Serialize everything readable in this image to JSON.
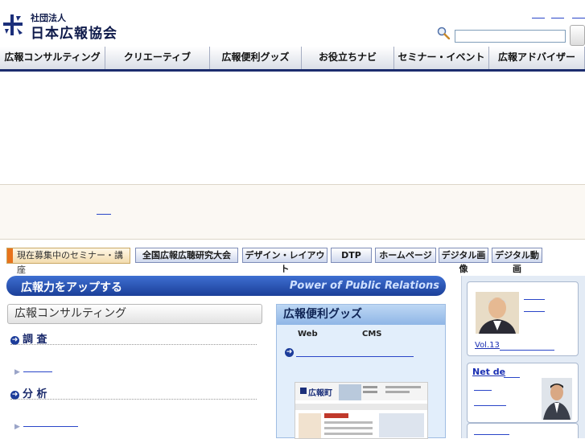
{
  "header": {
    "logo_small": "社団法人",
    "logo_big": "日本広報協会",
    "search_placeholder": ""
  },
  "nav": {
    "items": [
      {
        "label": "広報コンサルティング"
      },
      {
        "label": "クリエーティブ"
      },
      {
        "label": "広報便利グッズ"
      },
      {
        "label": "お役立ちナビ"
      },
      {
        "label": "セミナー・イベント"
      },
      {
        "label": "広報アドバイザー"
      }
    ]
  },
  "seminar_bar": {
    "label": "現在募集中のセミナー・講座",
    "buttons": [
      {
        "label": "全国広報広聴研究大会"
      },
      {
        "label": "デザイン・レイアウト"
      },
      {
        "label": "DTP"
      },
      {
        "label": "ホームページ"
      },
      {
        "label": "デジタル画像"
      },
      {
        "label": "デジタル動画"
      }
    ]
  },
  "main_banner": {
    "title": "広報力をアップする",
    "subtitle": "Power of Public Relations"
  },
  "consulting": {
    "heading": "広報コンサルティング",
    "sections": [
      {
        "label": "調 査"
      },
      {
        "label": "分 析"
      }
    ]
  },
  "goods": {
    "heading": "広報便利グッズ",
    "web_label": "Web",
    "cms_label": "CMS",
    "thumb_title": "広報町"
  },
  "right_column": {
    "card1_link": "Vol.13",
    "card2_title": "Net de"
  },
  "colors": {
    "nav_bg": "#1c2d6e",
    "accent_blue": "#1c3c9a",
    "link_blue": "#2a46c8",
    "seminar_orange": "#e8731b"
  }
}
